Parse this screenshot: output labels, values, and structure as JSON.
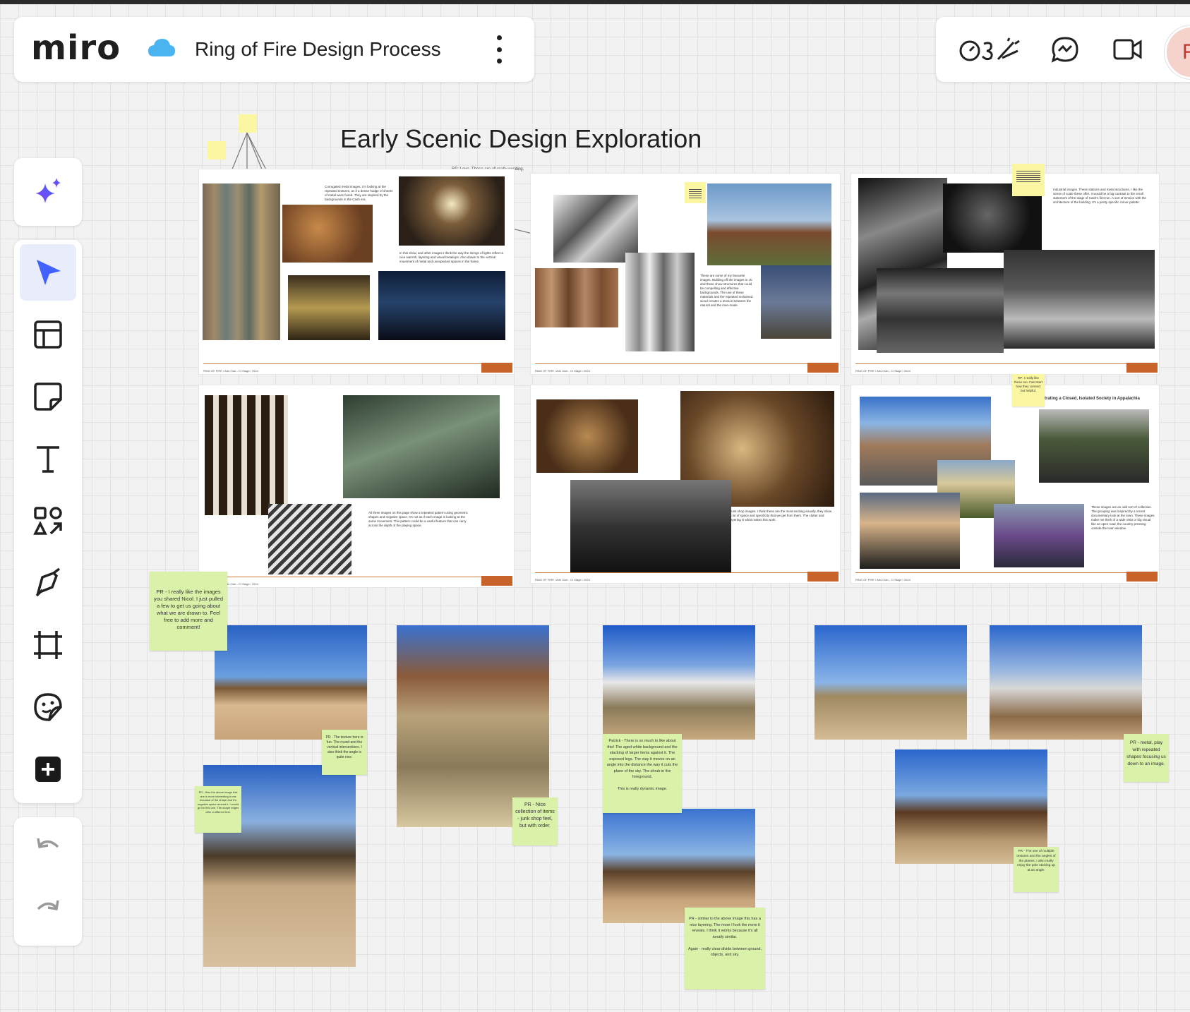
{
  "app": {
    "logo_text": "miro",
    "board_title": "Ring of Fire Design Process",
    "avatar_initial": "F"
  },
  "header_right": {
    "icons": [
      "reactions-icon",
      "comments-icon",
      "video-icon"
    ]
  },
  "toolbar": {
    "items": [
      "ai-sparkle-icon",
      "select-cursor-icon",
      "templates-icon",
      "sticky-note-icon",
      "text-icon",
      "shapes-icon",
      "pen-icon",
      "frame-icon",
      "stickers-icon",
      "add-more-icon"
    ],
    "undo_redo": [
      "undo-icon",
      "redo-icon"
    ],
    "accent": "#4262ff"
  },
  "canvas": {
    "title": "Early Scenic Design Exploration",
    "top_comment": "RP: Love. These are all really exciting."
  },
  "slides": {
    "slide1_text_a": "Corrugated metal images. I'm looking at the repeated textures, as if a dense hodge of sheets of metal were fused. They are inspired by the backgrounds in the Cash era.",
    "slide1_text_b": "In this show, and other images I think the way the strings of lights reflect a nice warmth, layering and visual breakups. Also drawn to the vertical movement of metal and unexpected spaces in the frame.",
    "slide2_text": "These are some of my favourite images. Building off the images in JC and these show structures that could be compelling and effective backgrounds. The use of these materials and the repeated reclaimed wood creates a tension between the natural and the man-made.",
    "slide3_text": "Industrial images. These stations and metal structures, I like the sense of scale these offer. It would be a big contrast to the small statement of the stage of Cash's first run. A sort of tension with the architecture of the building. It's a pretty specific colour palette.",
    "slide4_text": "All three images on this page show a repeated pattern using geometric shapes and negative space. It's not as if each image is looking at the same movement. This pattern could be a useful feature that can carry across the depth of the playing space.",
    "slide5_text": "Junk shop images. I think these are the most exciting visually, they show a lot of space and specificity that we get from them. The clutter and layering is what makes this work.",
    "slide6_title": "Illustrating a Closed, Isolated Society in Appalachia",
    "slide6_text": "These images are an odd sort of collection. The grouping was inspired by a recent documentary look at the town. These images make me think of a wide vista or big visual like an open road, the country pressing outside the town window.",
    "footer_label": "RING OF FIRE / Arts Club - CI Stage / 2024",
    "slide6_note": "RP: I really like these too. Fast start how they connect but helpful."
  },
  "stickies": {
    "s1": "PR - I really like the images you shared Nicol. I just pulled a few to get us going about what we are drawn to. Feel free to add more and comment!",
    "s2": "PR - The texture here is fun. The round and the vertical intersections. I also think the angle is quite nice.",
    "s3": "PR - Also the above image this one is more interesting to me because of the shape and it's negative space around it. I would go for this one. The shape edges offer a different feel.",
    "s4": "PR - Nice collection of items - junk shop feel, but with order.",
    "s5": "Patrick - There is so much to like about this! The aged white background and the stacking of larger items against it. The exposed legs. The way it moves on an angle into the distance the way it cuts the plane of the sky. The shrub in the foreground.\n\nThis is really dynamic image.",
    "s6": "PR - similar to the above image this has a nice layering. The more I look the more it reveals. I think it works because it's all tonally similar.\n\nAgain - really clear divide between ground, objects, and sky.",
    "s7": "PR - metal, play with repeated shapes focusing us down to an image.",
    "s8": "PR - The use of multiple textures and the angles of the planes. I also really enjoy the pole sticking up at an angle."
  }
}
